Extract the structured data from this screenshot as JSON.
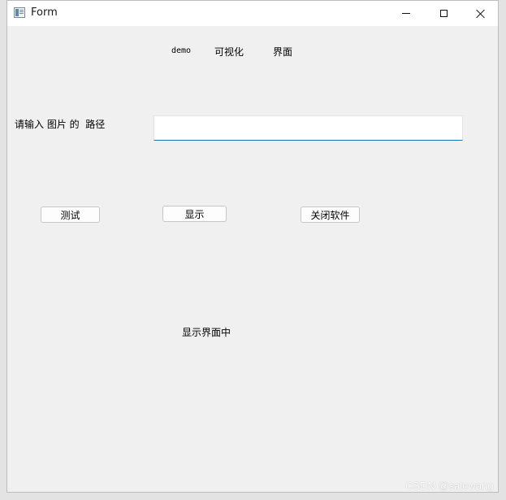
{
  "window": {
    "title": "Form",
    "icon": "form-window-icon",
    "controls": {
      "minimize_icon": "minimize-icon",
      "maximize_icon": "maximize-icon",
      "close_icon": "close-icon"
    }
  },
  "header": {
    "demo": "demo",
    "visual": "可视化",
    "interface": "界面"
  },
  "form": {
    "path_label": "请输入 图片 的  路径",
    "path_value": "",
    "path_placeholder": ""
  },
  "buttons": {
    "test": "测试",
    "show": "显示",
    "close_software": "关闭软件"
  },
  "display_label": "显示界面中",
  "watermark": "CSDN @salewang",
  "colors": {
    "window_bg": "#f0f0f0",
    "titlebar_bg": "#ffffff",
    "input_focus_line": "#1e6fa8"
  }
}
